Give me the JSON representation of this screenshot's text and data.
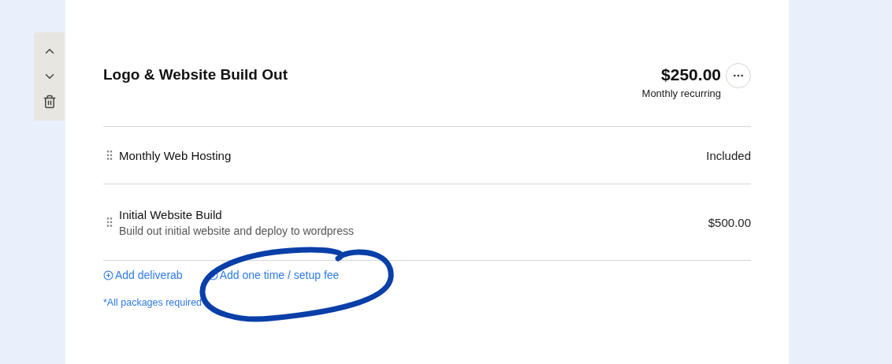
{
  "side_controls": [
    {
      "kind": "up"
    },
    {
      "kind": "down"
    },
    {
      "kind": "delete"
    }
  ],
  "package": {
    "title": "Logo & Website Build Out",
    "price": "$250.00",
    "billing": "Monthly recurring"
  },
  "deliverables": [
    {
      "name": "Monthly Web Hosting",
      "price": "Included"
    },
    {
      "name": "Initial Website Build",
      "description": "Build out initial website and deploy to wordpress",
      "price": "$500.00"
    }
  ],
  "links": [
    "Add deliverab",
    "Add one time / setup fee"
  ],
  "footnote": "*All packages required",
  "annotation": {
    "kind": "circle"
  }
}
